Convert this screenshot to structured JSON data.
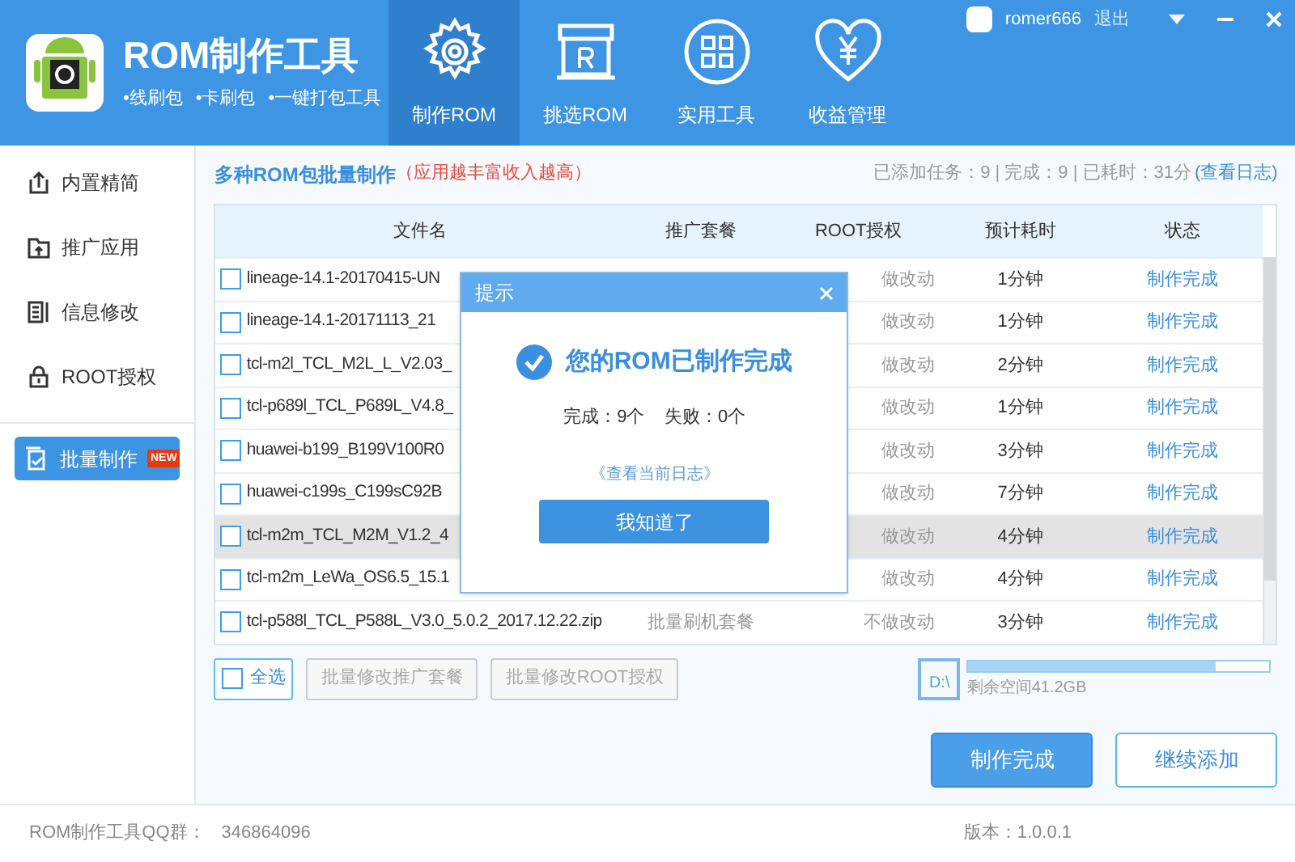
{
  "app": {
    "title": "ROM制作工具",
    "features": [
      "•线刷包",
      "•卡刷包",
      "•一键打包工具"
    ]
  },
  "nav_tabs": [
    {
      "label": "制作ROM",
      "selected": true
    },
    {
      "label": "挑选ROM",
      "selected": false
    },
    {
      "label": "实用工具",
      "selected": false
    },
    {
      "label": "收益管理",
      "selected": false
    }
  ],
  "user": {
    "name": "romer666",
    "logout": "退出"
  },
  "sidebar": {
    "items": [
      {
        "label": "内置精简",
        "selected": false
      },
      {
        "label": "推广应用",
        "selected": false
      },
      {
        "label": "信息修改",
        "selected": false
      },
      {
        "label": "ROOT授权",
        "selected": false
      },
      {
        "label": "批量制作",
        "selected": true,
        "badge": "NEW"
      }
    ]
  },
  "heading": {
    "title": "多种ROM包批量制作",
    "note": "（应用越丰富收入越高）",
    "stats": "已添加任务：9 | 完成：9 | 已耗时：31分",
    "log_link": "(查看日志)"
  },
  "table": {
    "columns": [
      "文件名",
      "推广套餐",
      "ROOT授权",
      "预计耗时",
      "状态"
    ],
    "rows": [
      {
        "file": "lineage-14.1-20170415-UN",
        "root": "做改动",
        "time": "1分钟",
        "status": "制作完成",
        "checked": false,
        "selected": false
      },
      {
        "file": "lineage-14.1-20171113_21",
        "root": "做改动",
        "time": "1分钟",
        "status": "制作完成",
        "checked": false,
        "selected": false
      },
      {
        "file": "tcl-m2l_TCL_M2L_L_V2.03_",
        "root": "做改动",
        "time": "2分钟",
        "status": "制作完成",
        "checked": false,
        "selected": false
      },
      {
        "file": "tcl-p689l_TCL_P689L_V4.8_",
        "root": "做改动",
        "time": "1分钟",
        "status": "制作完成",
        "checked": false,
        "selected": false
      },
      {
        "file": "huawei-b199_B199V100R0",
        "root": "做改动",
        "time": "3分钟",
        "status": "制作完成",
        "checked": false,
        "selected": false
      },
      {
        "file": "huawei-c199s_C199sC92B",
        "root": "做改动",
        "time": "7分钟",
        "status": "制作完成",
        "checked": false,
        "selected": false
      },
      {
        "file": "tcl-m2m_TCL_M2M_V1.2_4",
        "root": "做改动",
        "time": "4分钟",
        "status": "制作完成",
        "checked": false,
        "selected": true
      },
      {
        "file": "tcl-m2m_LeWa_OS6.5_15.1",
        "root": "做改动",
        "time": "4分钟",
        "status": "制作完成",
        "checked": false,
        "selected": false
      },
      {
        "file": "tcl-p588l_TCL_P588L_V3.0_5.0.2_2017.12.22.zip",
        "promo": "批量刷机套餐",
        "root": "不做改动",
        "time": "3分钟",
        "status": "制作完成",
        "checked": false,
        "selected": false
      }
    ]
  },
  "toolbar": {
    "select_all": {
      "label": "全选",
      "checked": false
    },
    "buttons": [
      {
        "label": "批量修改推广套餐",
        "disabled": true
      },
      {
        "label": "批量修改ROOT授权",
        "disabled": true
      }
    ]
  },
  "disk": {
    "drive": "D:\\",
    "level": 0.82,
    "free": "剩余空间41.2GB"
  },
  "actions": [
    {
      "label": "制作完成",
      "kind": "primary"
    },
    {
      "label": "继续添加",
      "kind": "secondary"
    }
  ],
  "dialog": {
    "title": "提示",
    "message": "您的ROM已制作完成",
    "summary": "完成：9个    失败：0个",
    "log_link": "《查看当前日志》",
    "button": "我知道了"
  },
  "footer": {
    "qq_label": "ROM制作工具QQ群：",
    "qq": "346864096",
    "version": "版本：1.0.0.1"
  }
}
